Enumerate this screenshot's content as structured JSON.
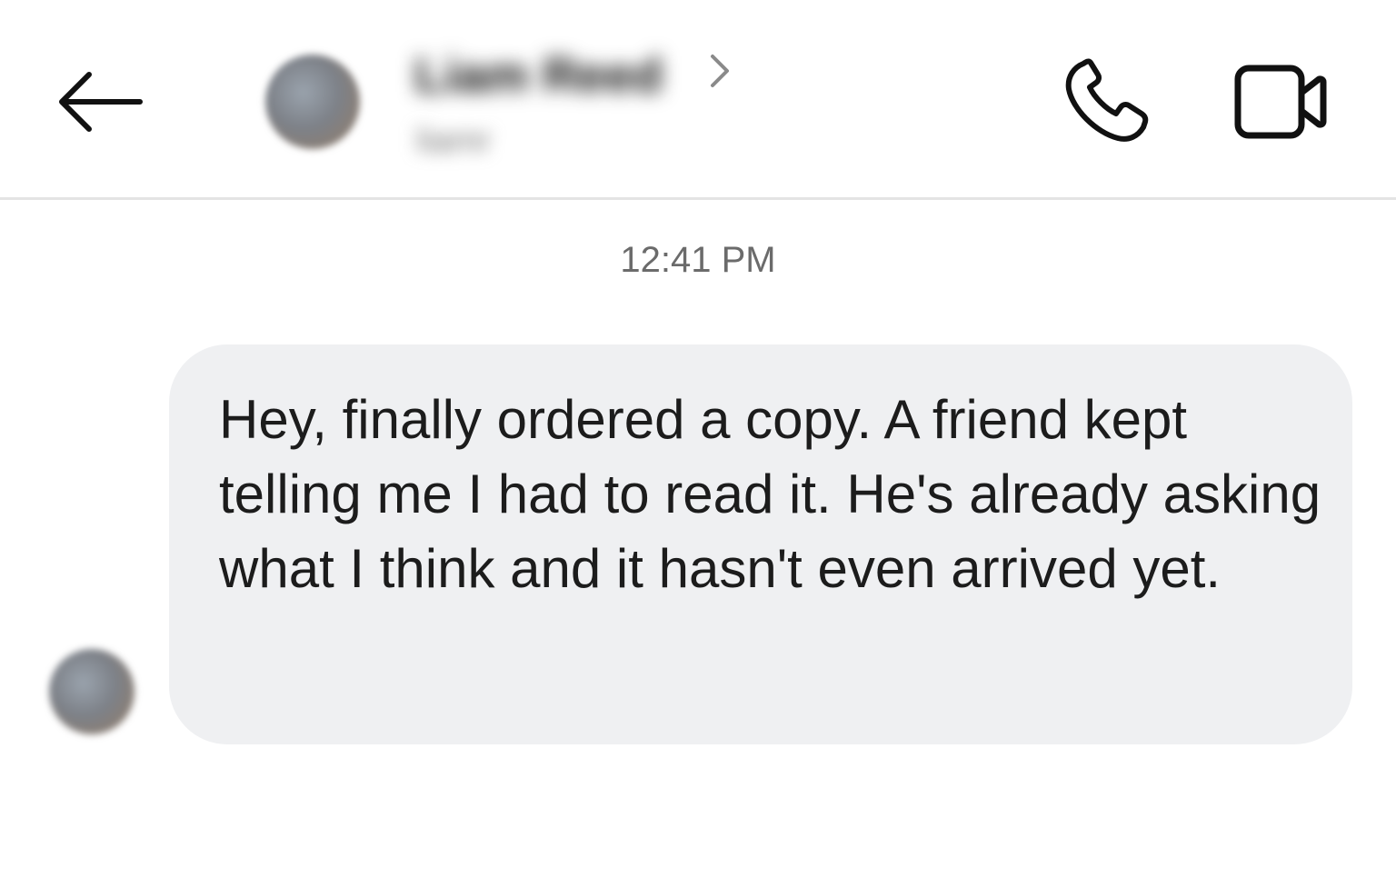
{
  "header": {
    "contact_name": "Liam Reed",
    "contact_subtitle": "liamr",
    "icons": {
      "back": "back-arrow-icon",
      "chevron": "chevron-right-icon",
      "call": "phone-icon",
      "video": "video-camera-icon"
    }
  },
  "conversation": {
    "timestamp": "12:41 PM",
    "messages": [
      {
        "sender": "contact",
        "text": "Hey, finally ordered a copy. A friend kept telling me I had to read it. He's already asking what I think and it hasn't even arrived yet."
      }
    ]
  },
  "colors": {
    "bubble_bg": "#eff0f2",
    "divider": "#e4e4e4",
    "timestamp": "#6b6b6b",
    "icon": "#111111"
  }
}
